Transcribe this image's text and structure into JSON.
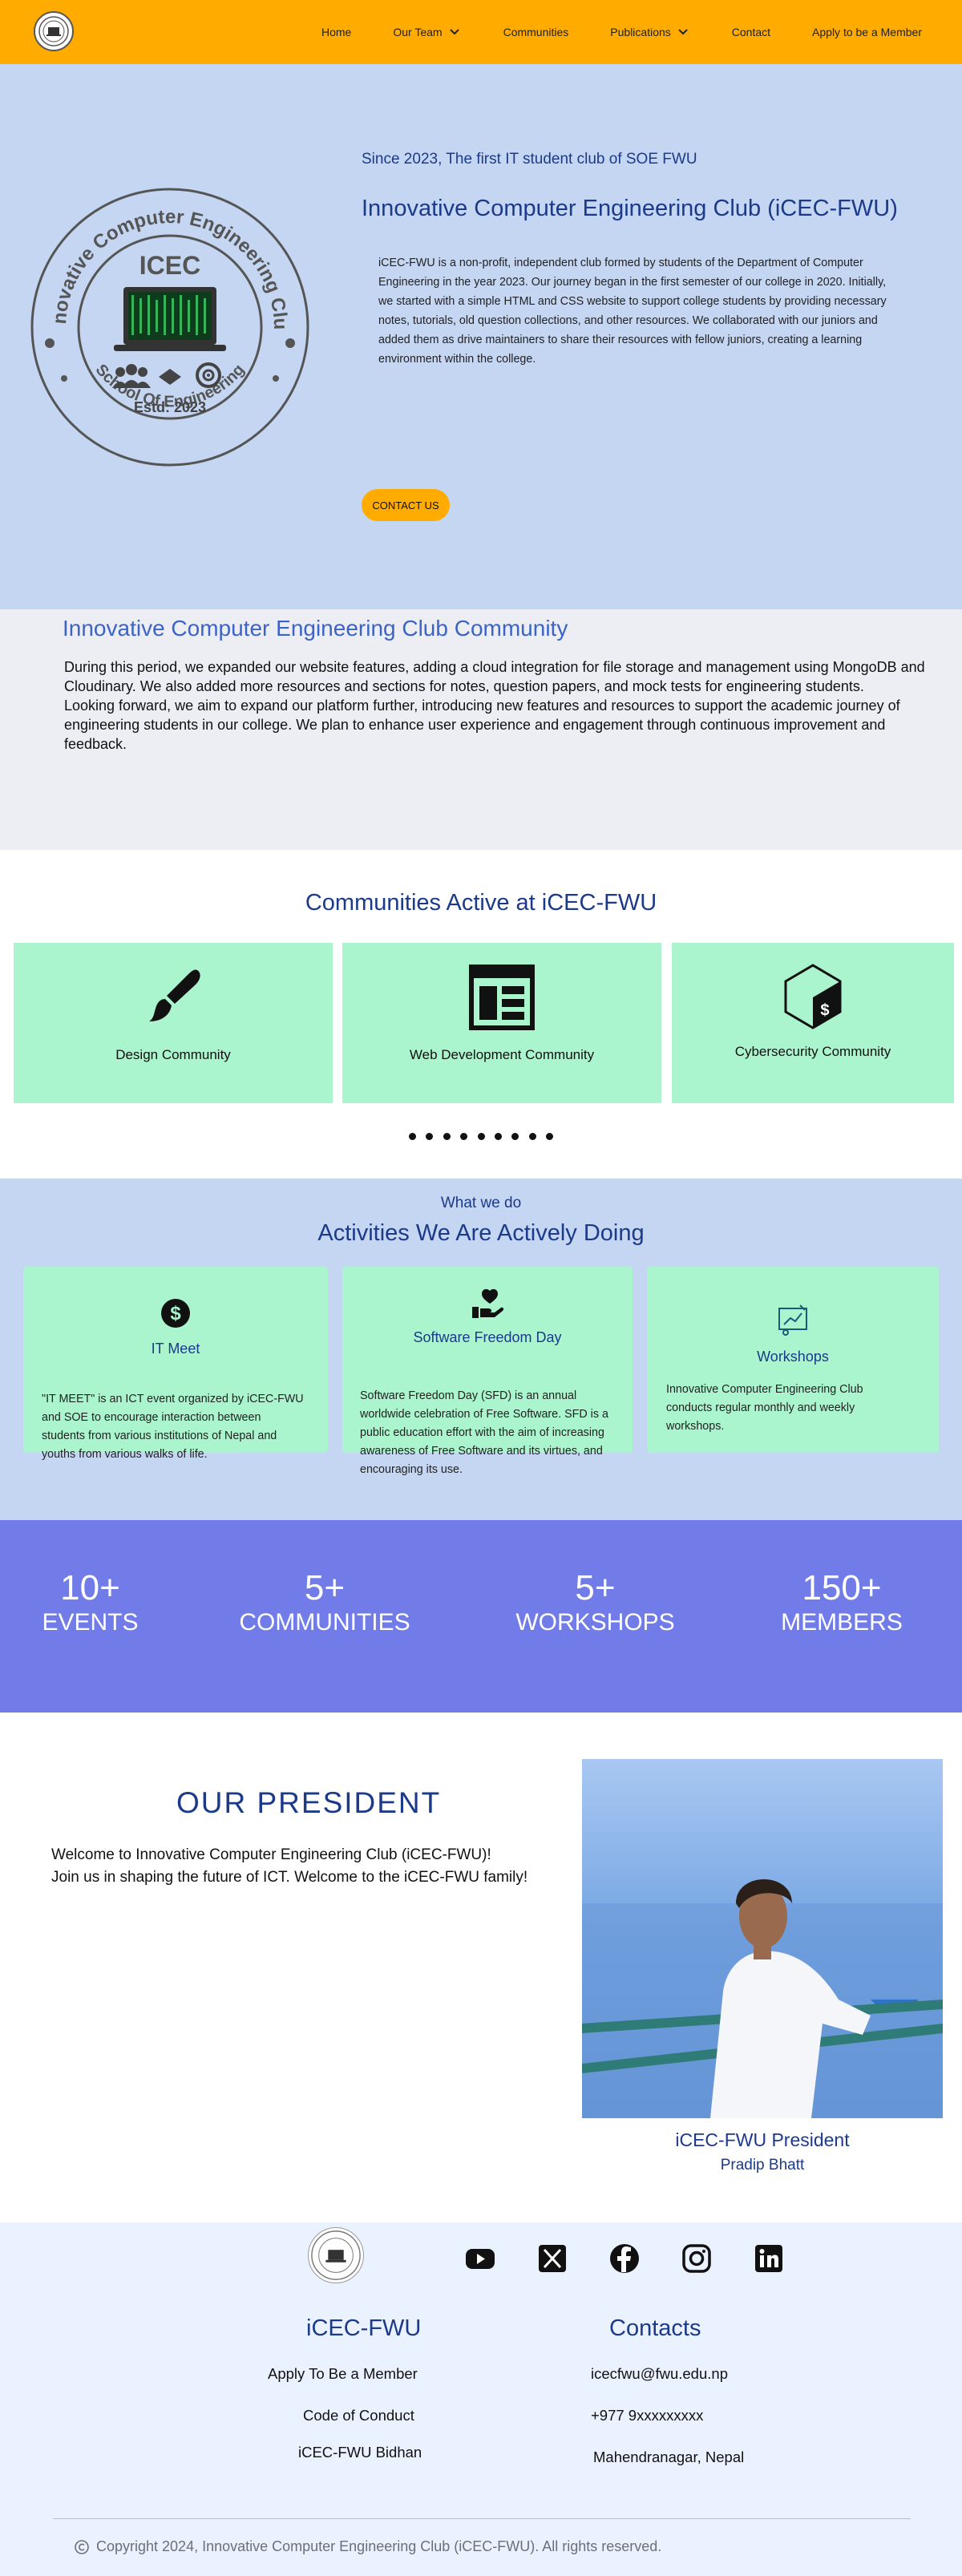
{
  "nav": {
    "items": [
      {
        "label": "Home"
      },
      {
        "label": "Our Team"
      },
      {
        "label": "Communities"
      },
      {
        "label": "Publications"
      },
      {
        "label": "Contact"
      },
      {
        "label": "Apply to be a Member"
      }
    ],
    "logo_icon": "icec-logo-icon"
  },
  "hero": {
    "subtitle": "Since 2023, The first IT student club of SOE FWU",
    "title": "Innovative Computer Engineering Club (iCEC-FWU)",
    "description": "iCEC-FWU is a non-profit, independent club formed by students of the Department of Computer Engineering in the year 2023. Our journey began in the first semester of our college in 2020. Initially, we started with a simple HTML and CSS website to support college students by providing necessary notes, tutorials, old question collections, and other resources. We collaborated with our juniors and added them as drive maintainers to share their resources with fellow juniors, creating a learning environment within the college.",
    "button": "CONTACT US",
    "emblem": {
      "ring_top": "Innovative Computer Engineering Club",
      "ring_bottom": "School Of Engineering",
      "center": "ICEC",
      "estd": "Estd: 2023"
    }
  },
  "about": {
    "title": "Innovative Computer Engineering Club Community",
    "para1": "During this period, we expanded our website features, adding a cloud integration for file storage and management using MongoDB and Cloudinary. We also added more resources and sections for notes, question papers, and mock tests for engineering students.",
    "para2": "Looking forward, we aim to expand our platform further, introducing new features and resources to support the academic journey of engineering students in our college. We plan to enhance user experience and engagement through continuous improvement and feedback."
  },
  "communities": {
    "title": "Communities Active at iCEC-FWU",
    "cards": [
      {
        "label": "Design Community",
        "icon": "paintbrush-icon"
      },
      {
        "label": "Web Development Community",
        "icon": "web-layout-icon"
      },
      {
        "label": "Cybersecurity Community",
        "icon": "terminal-hexagon-icon"
      }
    ],
    "dots": 9
  },
  "activities": {
    "kicker": "What we do",
    "title": "Activities We Are Actively Doing",
    "cards": [
      {
        "title": "IT Meet",
        "icon": "dollar-coin-icon",
        "desc": "\"IT MEET\" is an ICT event organized by iCEC-FWU and SOE to encourage interaction between students from various institutions of Nepal and youths from various walks of life."
      },
      {
        "title": "Software Freedom Day",
        "icon": "heart-hand-icon",
        "desc": "Software Freedom Day (SFD) is an annual worldwide celebration of Free Software. SFD is a public education effort with the aim of increasing awareness of Free Software and its virtues, and encouraging its use."
      },
      {
        "title": "Workshops",
        "icon": "presentation-icon",
        "desc": "Innovative Computer Engineering Club conducts regular monthly and weekly workshops."
      }
    ]
  },
  "stats": [
    {
      "number": "10+",
      "label": "EVENTS"
    },
    {
      "number": "5+",
      "label": "COMMUNITIES"
    },
    {
      "number": "5+",
      "label": "WORKSHOPS"
    },
    {
      "number": "150+",
      "label": "MEMBERS"
    }
  ],
  "president": {
    "heading": "OUR PRESIDENT",
    "line1": "Welcome to Innovative Computer Engineering Club (iCEC-FWU)!",
    "line2": "Join us in shaping the future of ICT. Welcome to the iCEC-FWU family!",
    "role": "iCEC-FWU President",
    "name": "Pradip Bhatt"
  },
  "footer": {
    "socials": [
      "youtube-icon",
      "x-icon",
      "facebook-icon",
      "instagram-icon",
      "linkedin-icon"
    ],
    "col1_title": "iCEC-FWU",
    "col1_links": [
      "Apply To Be a Member",
      "Code of Conduct",
      "iCEC-FWU Bidhan"
    ],
    "col2_title": "Contacts",
    "col2_links": [
      "icecfwu@fwu.edu.np",
      "+977 9xxxxxxxxx",
      "Mahendranagar, Nepal"
    ],
    "copyright": "Copyright 2024, Innovative Computer Engineering Club (iCEC-FWU). All rights reserved."
  },
  "colors": {
    "nav": "#ffab00",
    "hero_bg": "#c4d6f2",
    "card_green": "#aaf5ce",
    "stats_bg": "#717ce8",
    "heading_blue": "#1c3a8a"
  }
}
